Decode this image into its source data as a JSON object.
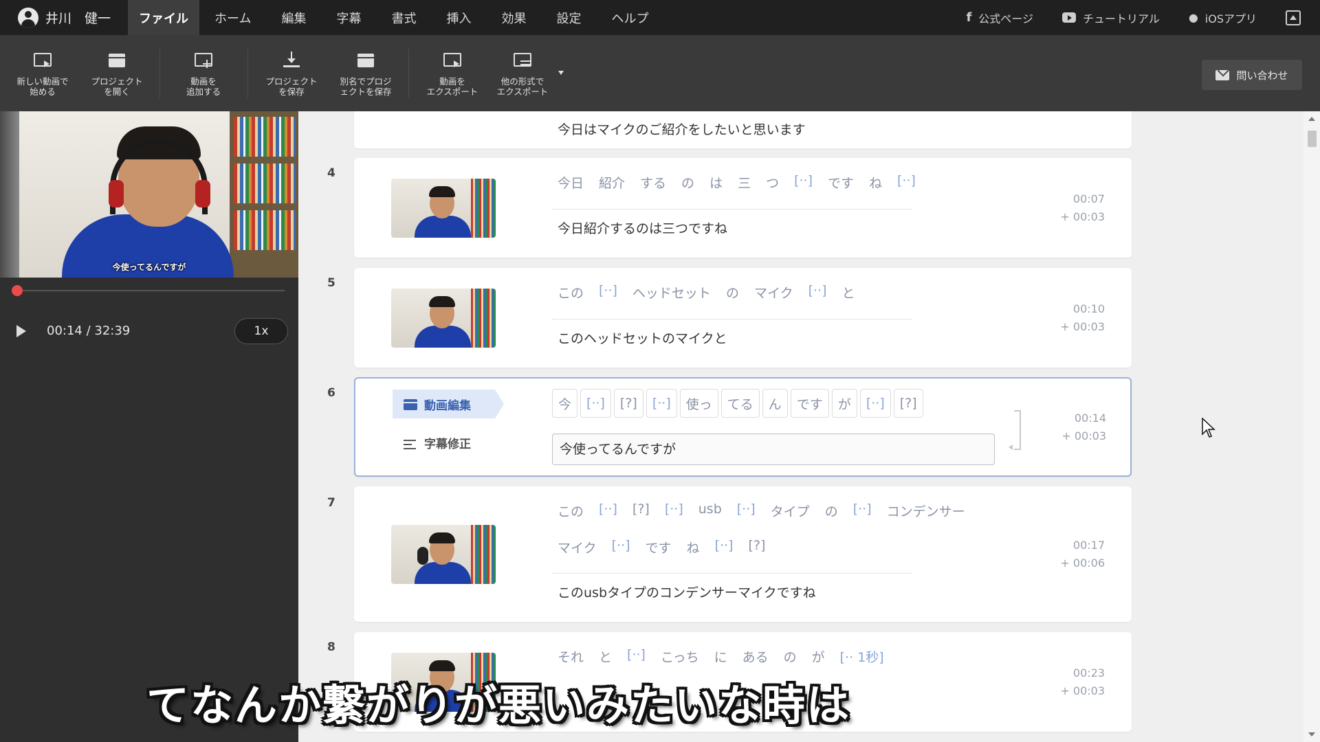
{
  "user": {
    "name": "井川　健一"
  },
  "menu": [
    {
      "label": "ファイル",
      "active": true
    },
    {
      "label": "ホーム"
    },
    {
      "label": "編集"
    },
    {
      "label": "字幕"
    },
    {
      "label": "書式"
    },
    {
      "label": "挿入"
    },
    {
      "label": "効果"
    },
    {
      "label": "設定"
    },
    {
      "label": "ヘルプ"
    }
  ],
  "toplinks": {
    "official": "公式ページ",
    "tutorial": "チュートリアル",
    "ios": "iOSアプリ"
  },
  "toolbar": [
    {
      "label": "新しい動画で\n始める",
      "icon": "new-video-icon"
    },
    {
      "label": "プロジェクト\nを開く",
      "icon": "open-project-icon"
    },
    {
      "label": "動画を\n追加する",
      "icon": "add-video-icon"
    },
    {
      "label": "プロジェクト\nを保存",
      "icon": "save-icon"
    },
    {
      "label": "別名でプロジ\nェクトを保存",
      "icon": "save-as-icon"
    },
    {
      "label": "動画を\nエクスポート",
      "icon": "export-video-icon"
    },
    {
      "label": "他の形式で\nエクスポート",
      "icon": "export-other-icon"
    }
  ],
  "contact_label": "問い合わせ",
  "player": {
    "caption": "今使ってるんですが",
    "time": "00:14 / 32:39",
    "speed": "1x",
    "progress": 0.007
  },
  "rows": {
    "prev_sentence": "今日はマイクのご紹介をしたいと思います",
    "r4": {
      "num": "4",
      "words": [
        "今日",
        "紹介",
        "する",
        "の",
        "は",
        "三",
        "つ",
        "[··]",
        "です",
        "ね",
        "[··]"
      ],
      "sentence": "今日紹介するのは三つですね",
      "start": "00:07",
      "dur": "+ 00:03"
    },
    "r5": {
      "num": "5",
      "words": [
        "この",
        "[··]",
        "ヘッドセット",
        "の",
        "マイク",
        "[··]",
        "と"
      ],
      "sentence": "このヘッドセットのマイクと",
      "start": "00:10",
      "dur": "+ 00:03"
    },
    "r6": {
      "num": "6",
      "tab_video": "動画編集",
      "tab_sub": "字幕修正",
      "chips": [
        "今",
        "[··]",
        "[?]",
        "[··]",
        "使っ",
        "てる",
        "ん",
        "です",
        "が",
        "[··]",
        "[?]"
      ],
      "sentence": "今使ってるんですが",
      "start": "00:14",
      "dur": "+ 00:03"
    },
    "r7": {
      "num": "7",
      "words1": [
        "この",
        "[··]",
        "[?]",
        "[··]",
        "usb",
        "[··]",
        "タイプ",
        "の",
        "[··]",
        "コンデンサー"
      ],
      "words2": [
        "マイク",
        "[··]",
        "です",
        "ね",
        "[··]",
        "[?]"
      ],
      "sentence": "このusbタイプのコンデンサーマイクですね",
      "start": "00:17",
      "dur": "+ 00:06"
    },
    "r8": {
      "num": "8",
      "words": [
        "それ",
        "と",
        "[··]",
        "こっち",
        "に",
        "ある",
        "の",
        "が",
        "[·· 1秒]"
      ],
      "start": "00:23",
      "dur": "+ 00:03"
    }
  },
  "overlay_subtitle": "てなんか繋がりが悪いみたいな時は"
}
